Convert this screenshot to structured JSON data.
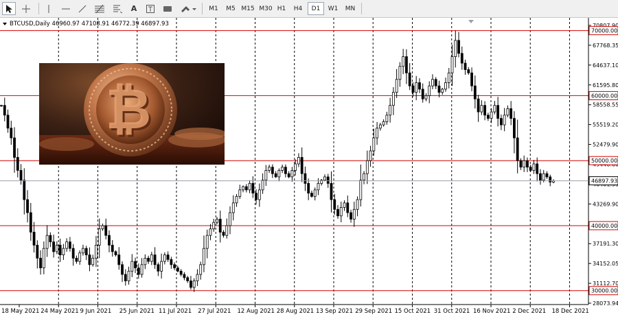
{
  "toolbar": {
    "timeframes": [
      "M1",
      "M5",
      "M15",
      "M30",
      "H1",
      "H4",
      "D1",
      "W1",
      "MN"
    ],
    "active_timeframe": "D1",
    "tools": [
      "cursor-icon",
      "crosshair-icon",
      "vertical-line-icon",
      "horizontal-line-icon",
      "trendline-icon",
      "fibonacci-icon",
      "gann-icon",
      "text-icon",
      "text-label-icon",
      "rectangle-icon",
      "arrows-icon"
    ]
  },
  "chart_header": {
    "symbol_line": "BTCUSD,Daily  46960.97 47108.91 46772.39 46897.93"
  },
  "image_inset": {
    "subject": "bitcoin-coin-photo"
  },
  "colors": {
    "level_line": "#d40000",
    "candle": "#000000",
    "grid": "#000000",
    "price_tag_bg": "#ffffff"
  },
  "chart_data": {
    "type": "candlestick",
    "ylim": [
      28073.94,
      70807.9
    ],
    "y_tick_labels": [
      "70807.90",
      "67768.35",
      "64637.10",
      "61595.80",
      "58558.55",
      "55519.20",
      "52479.90",
      "49440.60",
      "46401.35",
      "43269.90",
      "40230.55",
      "37191.30",
      "34152.05",
      "31112.70",
      "28073.94"
    ],
    "x_tick_labels": [
      "18 May 2021",
      "24 May 2021",
      "9 Jun 2021",
      "25 Jun 2021",
      "11 Jul 2021",
      "27 Jul 2021",
      "12 Aug 2021",
      "28 Aug 2021",
      "13 Sep 2021",
      "29 Sep 2021",
      "15 Oct 2021",
      "31 Oct 2021",
      "16 Nov 2021",
      "2 Dec 2021",
      "18 Dec 2021"
    ],
    "horizontal_levels": [
      {
        "value": 70000,
        "label": "70000.00"
      },
      {
        "value": 60000,
        "label": "60000.00"
      },
      {
        "value": 50000,
        "label": "50000.00"
      },
      {
        "value": 40000,
        "label": "40000.00"
      },
      {
        "value": 30000,
        "label": "30000.00"
      }
    ],
    "current_price": {
      "value": 46897.93,
      "label": "46897.93"
    },
    "close_path": [
      [
        0,
        58500
      ],
      [
        1,
        57000
      ],
      [
        2,
        55000
      ],
      [
        3,
        53500
      ],
      [
        4,
        50500
      ],
      [
        5,
        48500
      ],
      [
        6,
        47000
      ],
      [
        7,
        44000
      ],
      [
        8,
        42000
      ],
      [
        9,
        39000
      ],
      [
        10,
        37000
      ],
      [
        11,
        35000
      ],
      [
        12,
        33500
      ],
      [
        13,
        36500
      ],
      [
        14,
        38500
      ],
      [
        15,
        37500
      ],
      [
        16,
        36000
      ],
      [
        17,
        37000
      ],
      [
        18,
        35500
      ],
      [
        19,
        36500
      ],
      [
        20,
        37500
      ],
      [
        21,
        36500
      ],
      [
        22,
        35000
      ],
      [
        23,
        34500
      ],
      [
        24,
        35800
      ],
      [
        25,
        36500
      ],
      [
        26,
        35500
      ],
      [
        27,
        34000
      ],
      [
        28,
        35000
      ],
      [
        29,
        37000
      ],
      [
        30,
        39500
      ],
      [
        31,
        40000
      ],
      [
        32,
        38500
      ],
      [
        33,
        37000
      ],
      [
        34,
        36000
      ],
      [
        35,
        35500
      ],
      [
        36,
        34000
      ],
      [
        37,
        32500
      ],
      [
        38,
        31500
      ],
      [
        39,
        33000
      ],
      [
        40,
        34500
      ],
      [
        41,
        33500
      ],
      [
        42,
        32500
      ],
      [
        43,
        34000
      ],
      [
        44,
        35000
      ],
      [
        45,
        34500
      ],
      [
        46,
        35500
      ],
      [
        47,
        34000
      ],
      [
        48,
        33000
      ],
      [
        49,
        34500
      ],
      [
        50,
        35500
      ],
      [
        51,
        34800
      ],
      [
        52,
        34000
      ],
      [
        53,
        33500
      ],
      [
        54,
        33000
      ],
      [
        55,
        32500
      ],
      [
        56,
        32000
      ],
      [
        57,
        31500
      ],
      [
        58,
        30500
      ],
      [
        59,
        31500
      ],
      [
        60,
        32500
      ],
      [
        61,
        34000
      ],
      [
        62,
        36500
      ],
      [
        63,
        38500
      ],
      [
        64,
        39500
      ],
      [
        65,
        40500
      ],
      [
        66,
        41000
      ],
      [
        67,
        39000
      ],
      [
        68,
        38500
      ],
      [
        69,
        40000
      ],
      [
        70,
        42000
      ],
      [
        71,
        43500
      ],
      [
        72,
        44500
      ],
      [
        73,
        45500
      ],
      [
        74,
        46000
      ],
      [
        75,
        45500
      ],
      [
        76,
        46500
      ],
      [
        77,
        45000
      ],
      [
        78,
        44000
      ],
      [
        79,
        45500
      ],
      [
        80,
        47000
      ],
      [
        81,
        48500
      ],
      [
        82,
        49000
      ],
      [
        83,
        48000
      ],
      [
        84,
        47500
      ],
      [
        85,
        48500
      ],
      [
        86,
        49000
      ],
      [
        87,
        48000
      ],
      [
        88,
        47500
      ],
      [
        89,
        48500
      ],
      [
        90,
        49500
      ],
      [
        91,
        50500
      ],
      [
        92,
        48000
      ],
      [
        93,
        46500
      ],
      [
        94,
        45000
      ],
      [
        95,
        44500
      ],
      [
        96,
        45500
      ],
      [
        97,
        46500
      ],
      [
        98,
        47000
      ],
      [
        99,
        47500
      ],
      [
        100,
        46500
      ],
      [
        101,
        44000
      ],
      [
        102,
        42500
      ],
      [
        103,
        41500
      ],
      [
        104,
        42800
      ],
      [
        105,
        43500
      ],
      [
        106,
        42000
      ],
      [
        107,
        41000
      ],
      [
        108,
        42500
      ],
      [
        109,
        44000
      ],
      [
        110,
        47000
      ],
      [
        111,
        48000
      ],
      [
        112,
        50000
      ],
      [
        113,
        51500
      ],
      [
        114,
        53500
      ],
      [
        115,
        55000
      ],
      [
        116,
        55500
      ],
      [
        117,
        56000
      ],
      [
        118,
        57000
      ],
      [
        119,
        58500
      ],
      [
        120,
        60500
      ],
      [
        121,
        62500
      ],
      [
        122,
        64500
      ],
      [
        123,
        66000
      ],
      [
        124,
        63500
      ],
      [
        125,
        61500
      ],
      [
        126,
        60500
      ],
      [
        127,
        62000
      ],
      [
        128,
        61000
      ],
      [
        129,
        59500
      ],
      [
        130,
        60000
      ],
      [
        131,
        61500
      ],
      [
        132,
        62500
      ],
      [
        133,
        61500
      ],
      [
        134,
        60500
      ],
      [
        135,
        61000
      ],
      [
        136,
        62000
      ],
      [
        137,
        63500
      ],
      [
        138,
        66000
      ],
      [
        139,
        68500
      ],
      [
        140,
        66500
      ],
      [
        141,
        65000
      ],
      [
        142,
        64000
      ],
      [
        143,
        63500
      ],
      [
        144,
        61500
      ],
      [
        145,
        59500
      ],
      [
        146,
        57500
      ],
      [
        147,
        58500
      ],
      [
        148,
        57000
      ],
      [
        149,
        56500
      ],
      [
        150,
        57500
      ],
      [
        151,
        58500
      ],
      [
        152,
        56500
      ],
      [
        153,
        55500
      ],
      [
        154,
        57000
      ],
      [
        155,
        58000
      ],
      [
        156,
        56500
      ],
      [
        157,
        53500
      ],
      [
        158,
        50000
      ],
      [
        159,
        49000
      ],
      [
        160,
        50000
      ],
      [
        161,
        49000
      ],
      [
        162,
        48500
      ],
      [
        163,
        49500
      ],
      [
        164,
        48000
      ],
      [
        165,
        47000
      ],
      [
        166,
        48000
      ],
      [
        167,
        47500
      ],
      [
        168,
        46700
      ],
      [
        169,
        46897.93
      ]
    ],
    "grid": "vertical-dashed-at-date-ticks",
    "legend": "none"
  }
}
